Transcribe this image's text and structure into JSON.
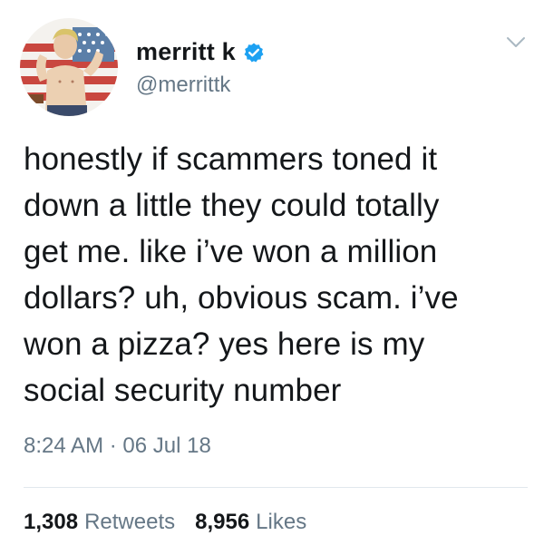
{
  "user": {
    "display_name": "merritt k",
    "handle": "@merrittk",
    "verified": true,
    "avatar_icon": "avatar-illustration"
  },
  "tweet": {
    "text": "honestly if scammers toned it\ndown a little they could totally\nget me. like i’ve won a million\ndollars? uh, obvious scam. i’ve\nwon a pizza? yes here is my\nsocial security number",
    "timestamp": "8:24 AM · 06 Jul 18"
  },
  "stats": {
    "retweets_count": "1,308",
    "retweets_label": "Retweets",
    "likes_count": "8,956",
    "likes_label": "Likes"
  },
  "colors": {
    "text_primary": "#14171a",
    "text_secondary": "#657786",
    "verified_blue": "#1da1f2",
    "divider": "#e1e8ed"
  }
}
